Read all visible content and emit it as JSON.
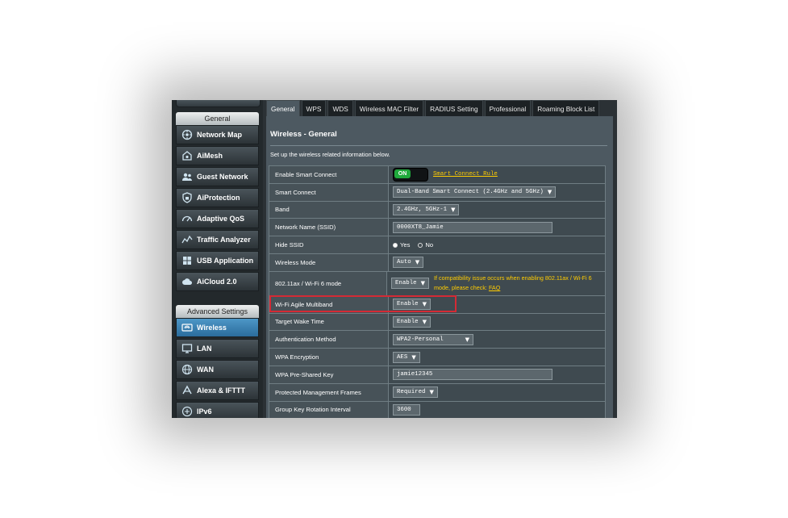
{
  "sidebar": {
    "general_heading": "General",
    "general_items": [
      {
        "label": "Network Map",
        "icon": "network-map-icon"
      },
      {
        "label": "AiMesh",
        "icon": "aimesh-icon"
      },
      {
        "label": "Guest Network",
        "icon": "guest-network-icon"
      },
      {
        "label": "AiProtection",
        "icon": "aiprotection-icon"
      },
      {
        "label": "Adaptive QoS",
        "icon": "adaptive-qos-icon"
      },
      {
        "label": "Traffic Analyzer",
        "icon": "traffic-analyzer-icon"
      },
      {
        "label": "USB Application",
        "icon": "usb-icon"
      },
      {
        "label": "AiCloud 2.0",
        "icon": "aicloud-icon"
      }
    ],
    "advanced_heading": "Advanced Settings",
    "advanced_items": [
      {
        "label": "Wireless",
        "icon": "wireless-icon",
        "active": true
      },
      {
        "label": "LAN",
        "icon": "lan-icon"
      },
      {
        "label": "WAN",
        "icon": "wan-icon"
      },
      {
        "label": "Alexa & IFTTT",
        "icon": "alexa-icon"
      },
      {
        "label": "IPv6",
        "icon": "ipv6-icon"
      }
    ]
  },
  "tabs": [
    "General",
    "WPS",
    "WDS",
    "Wireless MAC Filter",
    "RADIUS Setting",
    "Professional",
    "Roaming Block List"
  ],
  "main": {
    "title": "Wireless - General",
    "description": "Set up the wireless related information below.",
    "rows": {
      "smart_connect_enable": {
        "label": "Enable Smart Connect",
        "toggle": "ON",
        "link": "Smart Connect Rule"
      },
      "smart_connect": {
        "label": "Smart Connect",
        "value": "Dual-Band Smart Connect (2.4GHz and 5GHz)"
      },
      "band": {
        "label": "Band",
        "value": "2.4GHz, 5GHz-1"
      },
      "ssid": {
        "label": "Network Name (SSID)",
        "value": "0000XT8_Jamie"
      },
      "hide_ssid": {
        "label": "Hide SSID",
        "yes": "Yes",
        "no": "No"
      },
      "wireless_mode": {
        "label": "Wireless Mode",
        "value": "Auto"
      },
      "wifi6": {
        "label": "802.11ax / Wi-Fi 6 mode",
        "value": "Enable",
        "note": "If compatibility issue occurs when enabling 802.11ax / Wi-Fi 6 mode, please check:",
        "note_link": "FAQ"
      },
      "agile": {
        "label": "Wi-Fi Agile Multiband",
        "value": "Enable"
      },
      "twt": {
        "label": "Target Wake Time",
        "value": "Enable"
      },
      "auth": {
        "label": "Authentication Method",
        "value": "WPA2-Personal"
      },
      "wpa_enc": {
        "label": "WPA Encryption",
        "value": "AES"
      },
      "psk": {
        "label": "WPA Pre-Shared Key",
        "value": "jamie12345"
      },
      "pmf": {
        "label": "Protected Management Frames",
        "value": "Required"
      },
      "gkri": {
        "label": "Group Key Rotation Interval",
        "value": "3600"
      }
    }
  },
  "colors": {
    "accent": "#2b6c9c",
    "highlight": "#d42a35",
    "link": "#ffcc00",
    "toggle_on": "#1faa3c"
  }
}
